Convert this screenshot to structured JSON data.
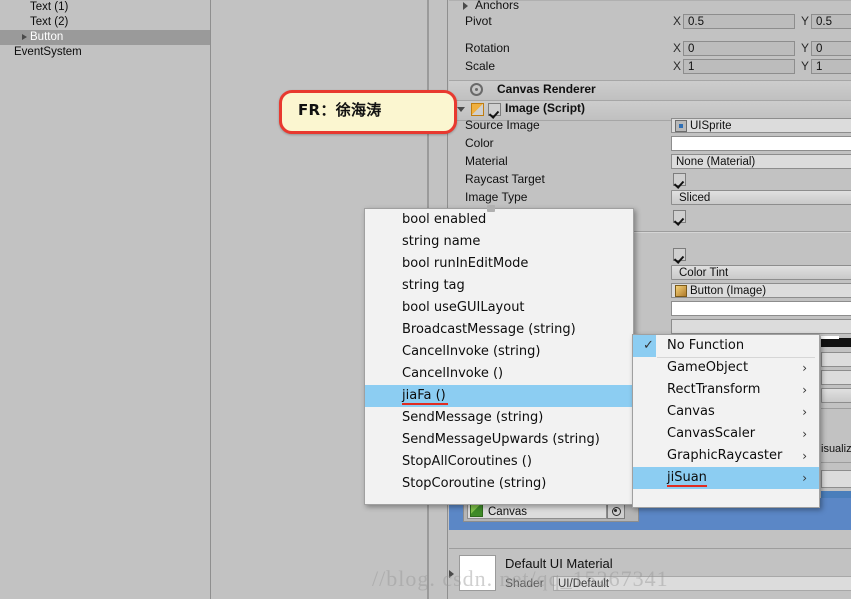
{
  "hierarchy": {
    "items": [
      {
        "label": "Text (1)",
        "indent": 30,
        "selected": false,
        "expandable": false
      },
      {
        "label": "Text (2)",
        "indent": 30,
        "selected": false,
        "expandable": false
      },
      {
        "label": "Button",
        "indent": 22,
        "selected": true,
        "expandable": true
      },
      {
        "label": "EventSystem",
        "indent": 14,
        "selected": false,
        "expandable": false
      }
    ]
  },
  "callout": {
    "text": "FR：徐海涛",
    "border_color": "#e8392f",
    "background_color": "#fbf6d0"
  },
  "inspector": {
    "rect_transform": {
      "anchors_label": "Anchors",
      "rows": [
        {
          "label": "Pivot",
          "x_axis": "X",
          "x_value": "0.5",
          "y_axis": "Y",
          "y_value": "0.5"
        },
        {
          "label": "Rotation",
          "x_axis": "X",
          "x_value": "0",
          "y_axis": "Y",
          "y_value": "0"
        },
        {
          "label": "Scale",
          "x_axis": "X",
          "x_value": "1",
          "y_axis": "Y",
          "y_value": "1"
        }
      ]
    },
    "canvas_renderer": {
      "title": "Canvas Renderer",
      "icon": "canvas-renderer-icon"
    },
    "image_script": {
      "title": "Image (Script)",
      "enabled": true,
      "fields": [
        {
          "label": "Source Image",
          "value": "UISprite",
          "kind": "object"
        },
        {
          "label": "Color",
          "value": "",
          "kind": "color"
        },
        {
          "label": "Material",
          "value": "None (Material)",
          "kind": "object"
        },
        {
          "label": "Raycast Target",
          "value": "",
          "kind": "checkbox",
          "checked": true
        },
        {
          "label": "Image Type",
          "value": "Sliced",
          "kind": "dropdown"
        },
        {
          "label": "",
          "value": "",
          "kind": "checkbox",
          "checked": true
        }
      ]
    },
    "button_script": {
      "interactable_checked": true,
      "transition": "Color Tint",
      "target_graphic": "Button (Image)",
      "extra_field_1": "",
      "extra_field_2": ""
    },
    "object_field": {
      "value": "Canvas",
      "picker_icon": "object-picker-icon"
    },
    "material_preview": {
      "name": "Default UI Material",
      "shader_label": "Shader",
      "shader_value": "UI/Default"
    },
    "side_label": "isualiz"
  },
  "menu_functions": {
    "items": [
      {
        "label": "bool enabled",
        "selected": false,
        "underline": false
      },
      {
        "label": "string name",
        "selected": false,
        "underline": false
      },
      {
        "label": "bool runInEditMode",
        "selected": false,
        "underline": false
      },
      {
        "label": "string tag",
        "selected": false,
        "underline": false
      },
      {
        "label": "bool useGUILayout",
        "selected": false,
        "underline": false
      },
      {
        "label": "BroadcastMessage (string)",
        "selected": false,
        "underline": false
      },
      {
        "label": "CancelInvoke (string)",
        "selected": false,
        "underline": false
      },
      {
        "label": "CancelInvoke ()",
        "selected": false,
        "underline": false
      },
      {
        "label": "jiaFa ()",
        "selected": true,
        "underline": true,
        "underline_width": 46
      },
      {
        "label": "SendMessage (string)",
        "selected": false,
        "underline": false
      },
      {
        "label": "SendMessageUpwards (string)",
        "selected": false,
        "underline": false
      },
      {
        "label": "StopAllCoroutines ()",
        "selected": false,
        "underline": false
      },
      {
        "label": "StopCoroutine (string)",
        "selected": false,
        "underline": false
      }
    ]
  },
  "menu_components": {
    "items": [
      {
        "label": "No Function",
        "selected": false,
        "checked": true,
        "submenu": false,
        "underline": false
      },
      {
        "label": "GameObject",
        "selected": false,
        "checked": false,
        "submenu": true,
        "underline": false
      },
      {
        "label": "RectTransform",
        "selected": false,
        "checked": false,
        "submenu": true,
        "underline": false
      },
      {
        "label": "Canvas",
        "selected": false,
        "checked": false,
        "submenu": true,
        "underline": false
      },
      {
        "label": "CanvasScaler",
        "selected": false,
        "checked": false,
        "submenu": true,
        "underline": false
      },
      {
        "label": "GraphicRaycaster",
        "selected": false,
        "checked": false,
        "submenu": true,
        "underline": false
      },
      {
        "label": "jiSuan",
        "selected": true,
        "checked": false,
        "submenu": true,
        "underline": true,
        "underline_width": 40
      }
    ],
    "submenu_arrow": "›",
    "check_glyph": "✓"
  },
  "watermark": {
    "text": "//blog. csdn. net/qq_15267341"
  }
}
